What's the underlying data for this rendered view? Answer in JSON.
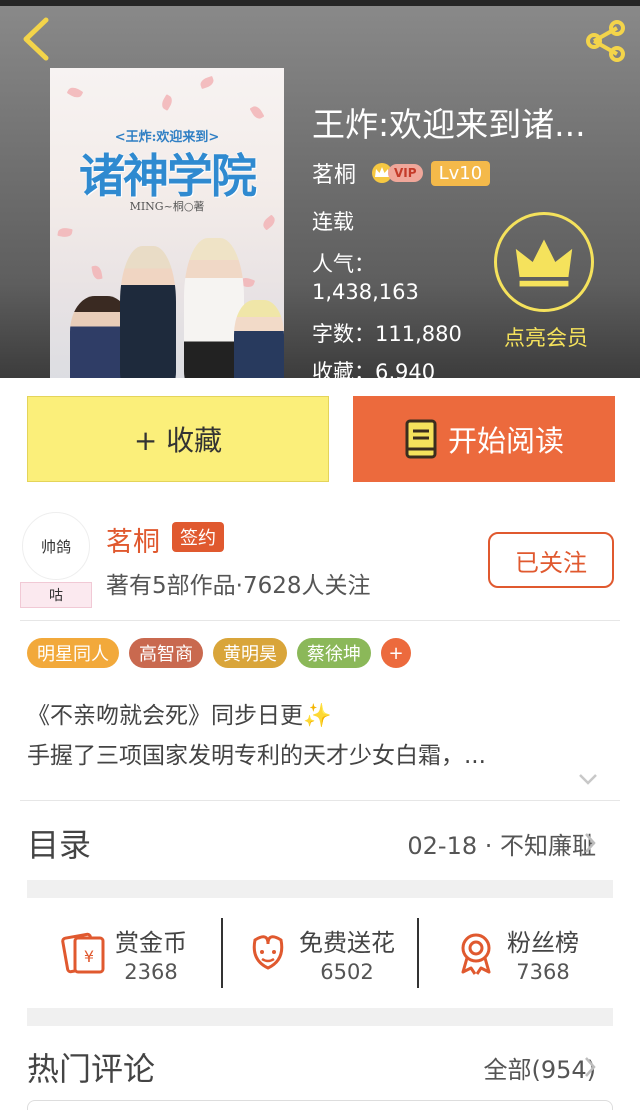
{
  "book": {
    "title": "王炸:欢迎来到诸...",
    "author": "茗桐",
    "vip_label": "VIP",
    "level": "Lv10",
    "status": "连载",
    "popularity_label": "人气：",
    "popularity_value": "1,438,163",
    "word_count_text": "字数：111,880",
    "favorites_text": "收藏：6,940",
    "vip_cta": "点亮会员"
  },
  "cover": {
    "subtitle": "<王炸:欢迎来到>",
    "main_title": "诸神学院",
    "author_line": "MING~桐○著"
  },
  "actions": {
    "favorite_label": "+ 收藏",
    "read_label": "开始阅读"
  },
  "author_card": {
    "avatar_text": "帅鸽",
    "avatar_tag": "咕",
    "name": "茗桐",
    "signed_label": "签约",
    "meta": "著有5部作品·7628人关注",
    "follow_label": "已关注"
  },
  "tags": [
    {
      "label": "明星同人",
      "color": "#f2a93b"
    },
    {
      "label": "高智商",
      "color": "#c9694f"
    },
    {
      "label": "黄明昊",
      "color": "#d9a53a"
    },
    {
      "label": "蔡徐坤",
      "color": "#8bb859"
    }
  ],
  "tag_add": "+",
  "description": {
    "line1": "《不亲吻就会死》同步日更✨",
    "line2": "手握了三项国家发明专利的天才少女白霜，..."
  },
  "catalog": {
    "title": "目录",
    "latest": "02-18 · 不知廉耻"
  },
  "stats": [
    {
      "label": "赏金币",
      "value": "2368",
      "icon": "reward-envelope-icon"
    },
    {
      "label": "免费送花",
      "value": "6502",
      "icon": "flower-icon"
    },
    {
      "label": "粉丝榜",
      "value": "7368",
      "icon": "medal-icon"
    }
  ],
  "comments": {
    "title": "热门评论",
    "all_label": "全部(954)"
  },
  "colors": {
    "accent": "#e0592f",
    "read_button": "#ec6a3d",
    "favorite_button": "#fbef7a",
    "vip_gold": "#f5e25c"
  }
}
